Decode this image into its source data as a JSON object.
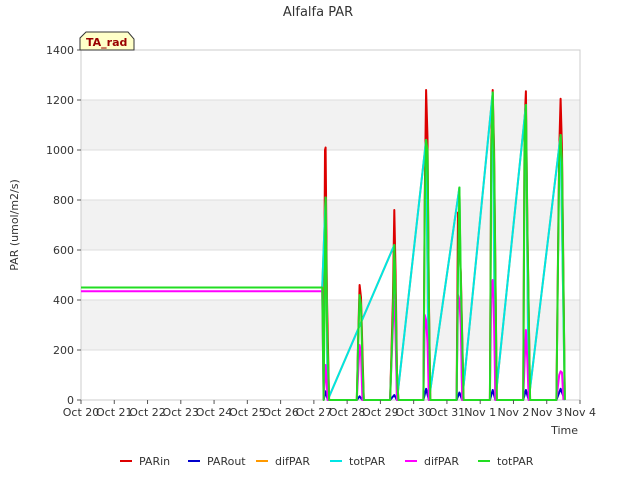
{
  "chart_data": {
    "type": "line",
    "title": "Alfalfa PAR",
    "xlabel": "Time",
    "ylabel": "PAR (umol/m2/s)",
    "ylim": [
      0,
      1400
    ],
    "yticks": [
      0,
      200,
      400,
      600,
      800,
      1000,
      1200,
      1400
    ],
    "xlim": [
      "2023-10-20",
      "2023-11-04"
    ],
    "xtick_labels": [
      "Oct 20",
      "Oct 21",
      "Oct 22",
      "Oct 23",
      "Oct 24",
      "Oct 25",
      "Oct 26",
      "Oct 27",
      "Oct 28",
      "Oct 29",
      "Oct 30",
      "Oct 31",
      "Nov 1",
      "Nov 2",
      "Nov 3",
      "Nov 4"
    ],
    "grid": "horizontal bands",
    "annotation": "TA_rad",
    "legend_position": "bottom",
    "series": [
      {
        "name": "PARin",
        "color": "#dd0000",
        "points": [
          [
            "2023-10-27 07:00",
            0
          ],
          [
            "2023-10-27 08:00",
            1000
          ],
          [
            "2023-10-27 08:30",
            1010
          ],
          [
            "2023-10-27 09:30",
            400
          ],
          [
            "2023-10-27 11:00",
            0
          ],
          [
            "2023-10-28 07:00",
            0
          ],
          [
            "2023-10-28 08:00",
            250
          ],
          [
            "2023-10-28 09:00",
            460
          ],
          [
            "2023-10-28 10:00",
            410
          ],
          [
            "2023-10-28 11:00",
            200
          ],
          [
            "2023-10-28 12:00",
            0
          ],
          [
            "2023-10-29 07:00",
            0
          ],
          [
            "2023-10-29 09:00",
            400
          ],
          [
            "2023-10-29 10:00",
            760
          ],
          [
            "2023-10-29 11:00",
            500
          ],
          [
            "2023-10-29 12:00",
            110
          ],
          [
            "2023-10-29 13:00",
            0
          ],
          [
            "2023-10-30 07:00",
            0
          ],
          [
            "2023-10-30 08:00",
            830
          ],
          [
            "2023-10-30 09:00",
            1240
          ],
          [
            "2023-10-30 10:00",
            1050
          ],
          [
            "2023-10-30 11:00",
            400
          ],
          [
            "2023-10-30 12:00",
            0
          ],
          [
            "2023-10-31 07:00",
            0
          ],
          [
            "2023-10-31 08:00",
            750
          ],
          [
            "2023-10-31 09:00",
            600
          ],
          [
            "2023-10-31 10:00",
            510
          ],
          [
            "2023-10-31 12:00",
            0
          ],
          [
            "2023-11-01 07:00",
            0
          ],
          [
            "2023-11-01 08:00",
            1040
          ],
          [
            "2023-11-01 09:00",
            1240
          ],
          [
            "2023-11-01 10:00",
            1000
          ],
          [
            "2023-11-01 12:00",
            0
          ],
          [
            "2023-11-02 07:00",
            0
          ],
          [
            "2023-11-02 08:00",
            1110
          ],
          [
            "2023-11-02 09:00",
            1235
          ],
          [
            "2023-11-02 10:00",
            720
          ],
          [
            "2023-11-02 12:00",
            0
          ],
          [
            "2023-11-03 07:00",
            0
          ],
          [
            "2023-11-03 09:00",
            1000
          ],
          [
            "2023-11-03 10:00",
            1205
          ],
          [
            "2023-11-03 11:00",
            1000
          ],
          [
            "2023-11-03 13:00",
            0
          ]
        ]
      },
      {
        "name": "PARout",
        "color": "#0000cc",
        "points": [
          [
            "2023-10-27 07:00",
            0
          ],
          [
            "2023-10-27 08:30",
            35
          ],
          [
            "2023-10-27 10:00",
            0
          ],
          [
            "2023-10-28 07:00",
            0
          ],
          [
            "2023-10-28 09:00",
            15
          ],
          [
            "2023-10-28 11:00",
            0
          ],
          [
            "2023-10-29 07:00",
            0
          ],
          [
            "2023-10-29 10:00",
            20
          ],
          [
            "2023-10-29 12:00",
            0
          ],
          [
            "2023-10-30 07:00",
            0
          ],
          [
            "2023-10-30 09:00",
            45
          ],
          [
            "2023-10-30 11:00",
            0
          ],
          [
            "2023-10-31 07:00",
            0
          ],
          [
            "2023-10-31 09:00",
            30
          ],
          [
            "2023-10-31 11:00",
            0
          ],
          [
            "2023-11-01 07:00",
            0
          ],
          [
            "2023-11-01 09:00",
            40
          ],
          [
            "2023-11-01 11:00",
            0
          ],
          [
            "2023-11-02 07:00",
            0
          ],
          [
            "2023-11-02 09:00",
            40
          ],
          [
            "2023-11-02 11:00",
            0
          ],
          [
            "2023-11-03 07:00",
            0
          ],
          [
            "2023-11-03 10:00",
            45
          ],
          [
            "2023-11-03 13:00",
            0
          ]
        ]
      },
      {
        "name": "difPAR",
        "color": "#ff9900",
        "points": [
          [
            "2023-10-20 00:00",
            450
          ],
          [
            "2023-10-27 06:00",
            450
          ],
          [
            "2023-10-27 08:30",
            810
          ],
          [
            "2023-10-27 10:00",
            0
          ],
          [
            "2023-10-29 10:00",
            620
          ],
          [
            "2023-10-29 12:00",
            0
          ],
          [
            "2023-10-30 09:00",
            1040
          ],
          [
            "2023-10-30 11:00",
            0
          ],
          [
            "2023-10-31 09:00",
            850
          ],
          [
            "2023-10-31 11:00",
            0
          ],
          [
            "2023-11-01 09:00",
            1230
          ],
          [
            "2023-11-01 11:00",
            0
          ],
          [
            "2023-11-02 09:00",
            1180
          ],
          [
            "2023-11-02 11:00",
            0
          ],
          [
            "2023-11-03 10:00",
            1060
          ],
          [
            "2023-11-03 13:00",
            0
          ]
        ]
      },
      {
        "name": "totPAR",
        "color": "#00e5e5",
        "points": [
          [
            "2023-10-20 00:00",
            450
          ],
          [
            "2023-10-27 06:00",
            450
          ],
          [
            "2023-10-27 08:30",
            810
          ],
          [
            "2023-10-27 10:00",
            0
          ],
          [
            "2023-10-29 10:00",
            620
          ],
          [
            "2023-10-29 12:00",
            0
          ],
          [
            "2023-10-30 09:00",
            1040
          ],
          [
            "2023-10-30 11:00",
            0
          ],
          [
            "2023-10-31 09:00",
            850
          ],
          [
            "2023-10-31 11:00",
            0
          ],
          [
            "2023-11-01 09:00",
            1230
          ],
          [
            "2023-11-01 11:00",
            0
          ],
          [
            "2023-11-02 09:00",
            1180
          ],
          [
            "2023-11-02 11:00",
            0
          ],
          [
            "2023-11-03 10:00",
            1060
          ],
          [
            "2023-11-03 13:00",
            0
          ]
        ]
      },
      {
        "name": "difPAR",
        "color": "#ff00ff",
        "points": [
          [
            "2023-10-20 00:00",
            435
          ],
          [
            "2023-10-27 06:00",
            435
          ],
          [
            "2023-10-27 07:00",
            0
          ],
          [
            "2023-10-27 08:30",
            140
          ],
          [
            "2023-10-27 10:00",
            0
          ],
          [
            "2023-10-28 07:00",
            0
          ],
          [
            "2023-10-28 09:00",
            220
          ],
          [
            "2023-10-28 10:00",
            190
          ],
          [
            "2023-10-28 11:00",
            0
          ],
          [
            "2023-10-29 07:00",
            0
          ],
          [
            "2023-10-29 09:00",
            300
          ],
          [
            "2023-10-29 10:00",
            420
          ],
          [
            "2023-10-29 11:00",
            250
          ],
          [
            "2023-10-29 12:00",
            0
          ],
          [
            "2023-10-30 07:00",
            0
          ],
          [
            "2023-10-30 08:00",
            340
          ],
          [
            "2023-10-30 09:00",
            320
          ],
          [
            "2023-10-30 10:00",
            230
          ],
          [
            "2023-10-30 11:00",
            0
          ],
          [
            "2023-10-31 07:00",
            0
          ],
          [
            "2023-10-31 08:00",
            420
          ],
          [
            "2023-10-31 09:00",
            400
          ],
          [
            "2023-10-31 10:00",
            300
          ],
          [
            "2023-10-31 11:00",
            0
          ],
          [
            "2023-11-01 07:00",
            0
          ],
          [
            "2023-11-01 08:00",
            450
          ],
          [
            "2023-11-01 09:00",
            480
          ],
          [
            "2023-11-01 10:00",
            300
          ],
          [
            "2023-11-01 11:00",
            0
          ],
          [
            "2023-11-02 07:00",
            0
          ],
          [
            "2023-11-02 08:00",
            150
          ],
          [
            "2023-11-02 09:00",
            280
          ],
          [
            "2023-11-02 10:00",
            160
          ],
          [
            "2023-11-02 11:00",
            0
          ],
          [
            "2023-11-03 07:00",
            0
          ],
          [
            "2023-11-03 09:00",
            100
          ],
          [
            "2023-11-03 10:00",
            115
          ],
          [
            "2023-11-03 11:00",
            110
          ],
          [
            "2023-11-03 12:00",
            0
          ]
        ]
      },
      {
        "name": "totPAR",
        "color": "#22dd22",
        "points": [
          [
            "2023-10-20 00:00",
            450
          ],
          [
            "2023-10-27 06:00",
            450
          ],
          [
            "2023-10-27 07:00",
            0
          ],
          [
            "2023-10-27 08:30",
            810
          ],
          [
            "2023-10-27 09:30",
            300
          ],
          [
            "2023-10-27 11:00",
            0
          ],
          [
            "2023-10-28 07:00",
            0
          ],
          [
            "2023-10-28 08:00",
            240
          ],
          [
            "2023-10-28 09:00",
            420
          ],
          [
            "2023-10-28 10:00",
            380
          ],
          [
            "2023-10-28 11:00",
            150
          ],
          [
            "2023-10-28 12:00",
            0
          ],
          [
            "2023-10-29 07:00",
            0
          ],
          [
            "2023-10-29 09:00",
            330
          ],
          [
            "2023-10-29 10:00",
            620
          ],
          [
            "2023-10-29 11:00",
            420
          ],
          [
            "2023-10-29 12:00",
            90
          ],
          [
            "2023-10-29 13:00",
            0
          ],
          [
            "2023-10-30 07:00",
            0
          ],
          [
            "2023-10-30 08:00",
            800
          ],
          [
            "2023-10-30 09:00",
            1040
          ],
          [
            "2023-10-30 10:00",
            1000
          ],
          [
            "2023-10-30 11:00",
            380
          ],
          [
            "2023-10-30 12:00",
            0
          ],
          [
            "2023-10-31 07:00",
            0
          ],
          [
            "2023-10-31 08:00",
            500
          ],
          [
            "2023-10-31 09:00",
            850
          ],
          [
            "2023-10-31 10:00",
            480
          ],
          [
            "2023-10-31 12:00",
            0
          ],
          [
            "2023-11-01 07:00",
            0
          ],
          [
            "2023-11-01 08:00",
            1000
          ],
          [
            "2023-11-01 09:00",
            1230
          ],
          [
            "2023-11-01 10:00",
            950
          ],
          [
            "2023-11-01 12:00",
            0
          ],
          [
            "2023-11-02 07:00",
            0
          ],
          [
            "2023-11-02 08:00",
            1060
          ],
          [
            "2023-11-02 09:00",
            1180
          ],
          [
            "2023-11-02 10:00",
            700
          ],
          [
            "2023-11-02 12:00",
            0
          ],
          [
            "2023-11-03 07:00",
            0
          ],
          [
            "2023-11-03 09:00",
            950
          ],
          [
            "2023-11-03 10:00",
            1060
          ],
          [
            "2023-11-03 11:00",
            950
          ],
          [
            "2023-11-03 13:00",
            0
          ]
        ]
      }
    ]
  }
}
